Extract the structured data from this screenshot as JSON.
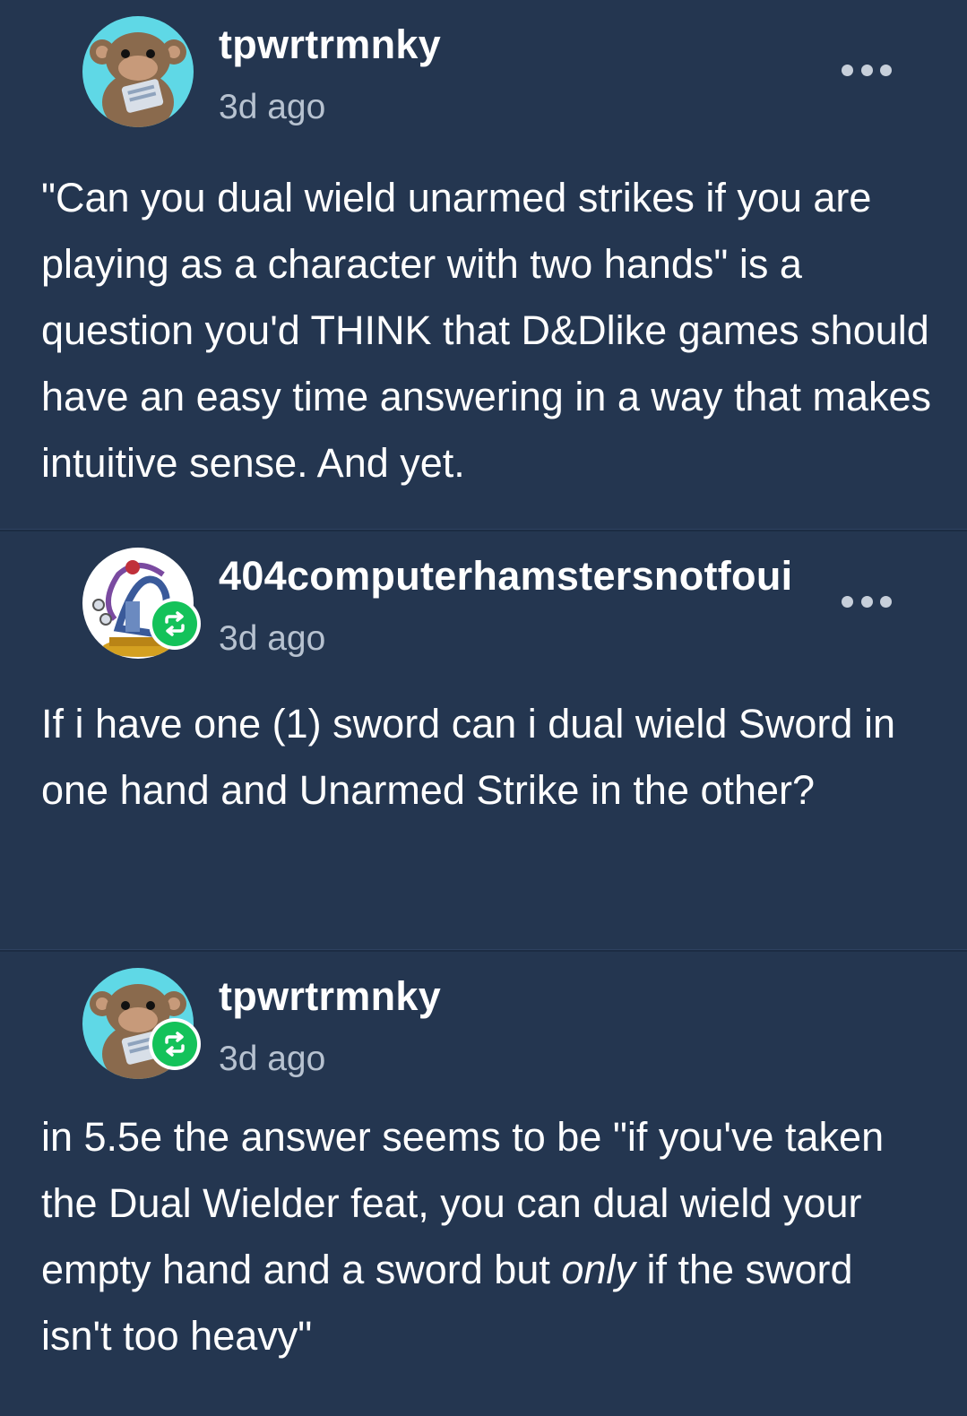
{
  "posts": [
    {
      "username": "tpwrtrmnky",
      "timestamp": "3d ago",
      "avatar_icon": "monkey-avatar",
      "reblogged": false,
      "body": "\"Can you dual wield unarmed strikes if you are playing as a character with two hands\" is a question you'd THINK that D&Dlike games should have an easy time answering in a way that makes intuitive sense. And yet."
    },
    {
      "username": "404computerhamstersnotfoui",
      "timestamp": "3d ago",
      "avatar_icon": "trophy-avatar",
      "reblogged": true,
      "body": "If i have one (1) sword can i dual wield Sword in one hand and Unarmed Strike in the other?"
    },
    {
      "username": "tpwrtrmnky",
      "timestamp": "3d ago",
      "avatar_icon": "monkey-avatar",
      "reblogged": true,
      "body_before_em": "in 5.5e the answer seems to be \"if you've taken the Dual Wielder feat, you can dual wield your empty hand and a sword but ",
      "body_em": "only",
      "body_after_em": " if the sword isn't too heavy\""
    }
  ],
  "colors": {
    "background": "#243650",
    "text": "#ffffff",
    "muted": "#b7c2d0",
    "reblog_green": "#14c25a"
  },
  "icons": {
    "more": "more-horizontal-icon",
    "reblog": "reblog-icon"
  }
}
